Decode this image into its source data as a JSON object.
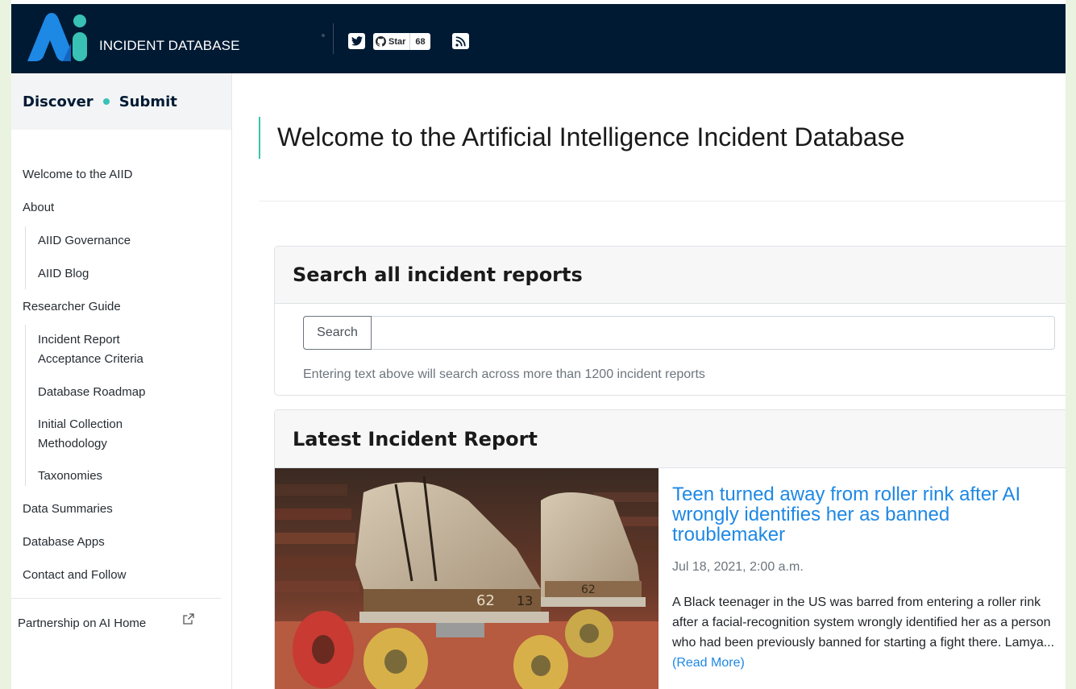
{
  "header": {
    "brand": "INCIDENT DATABASE",
    "github_star_label": "Star",
    "github_star_count": "68",
    "colors": {
      "background": "#001a33",
      "logo_blue": "#1e88e5",
      "logo_teal": "#3ac1b5"
    }
  },
  "sidebar": {
    "discover": "Discover",
    "submit": "Submit",
    "items": [
      {
        "label": "Welcome to the AIID"
      },
      {
        "label": "About"
      },
      {
        "label": "AIID Governance"
      },
      {
        "label": "AIID Blog"
      },
      {
        "label": "Researcher Guide"
      },
      {
        "label": "Incident Report Acceptance Criteria"
      },
      {
        "label": "Database Roadmap"
      },
      {
        "label": "Initial Collection Methodology"
      },
      {
        "label": "Taxonomies"
      },
      {
        "label": "Data Summaries"
      },
      {
        "label": "Database Apps"
      },
      {
        "label": "Contact and Follow"
      }
    ],
    "external_link": "Partnership on AI Home"
  },
  "main": {
    "title": "Welcome to the Artificial Intelligence Incident Database",
    "search": {
      "heading": "Search all incident reports",
      "button_label": "Search",
      "value": "",
      "placeholder": "",
      "hint": "Entering text above will search across more than 1200 incident reports"
    },
    "latest": {
      "heading": "Latest Incident Report",
      "title": "Teen turned away from roller rink after AI wrongly identifies her as banned troublemaker",
      "date": "Jul 18, 2021, 2:00 a.m.",
      "excerpt": "A Black teenager in the US was barred from entering a roller rink after a facial-recognition system wrongly identified her as a person who had been previously banned for starting a fight there. Lamya...",
      "read_more": "(Read More)",
      "skate_numbers": [
        "62",
        "13",
        "62"
      ]
    }
  }
}
